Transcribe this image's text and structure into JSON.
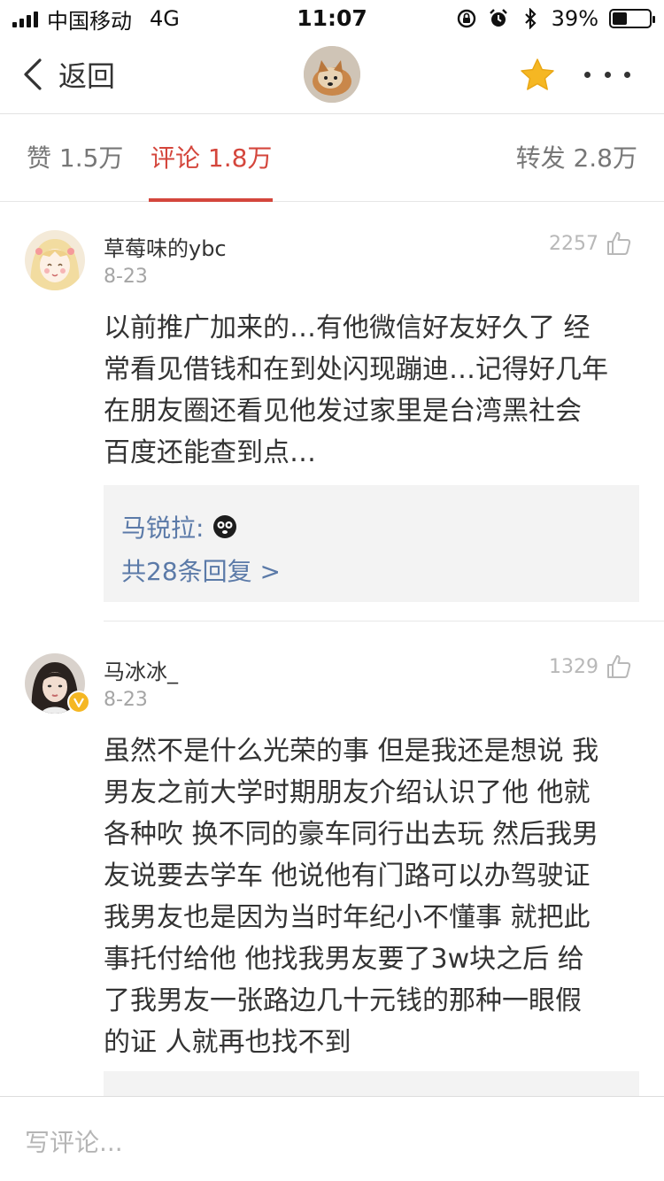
{
  "status_bar": {
    "carrier": "中国移动",
    "network": "4G",
    "time": "11:07",
    "battery_percent": "39%",
    "battery_level": 0.39
  },
  "nav": {
    "back_label": "返回",
    "star_color": "#f5b723"
  },
  "tabs": {
    "likes": "赞 1.5万",
    "comments": "评论 1.8万",
    "reposts": "转发 2.8万",
    "active_color": "#d4463c"
  },
  "comments": [
    {
      "username": "草莓味的ybc",
      "date": "8-23",
      "likes": "2257",
      "lines": [
        "以前推广加来的…有他微信好友好久了 经",
        "常看见借钱和在到处闪现蹦迪…记得好几年",
        "在朋友圈还看见他发过家里是台湾黑社会",
        "百度还能查到点…"
      ],
      "reply_author": "马锐拉:",
      "reply_count": "共28条回复 >"
    },
    {
      "username": "马冰冰_",
      "date": "8-23",
      "likes": "1329",
      "lines": [
        "虽然不是什么光荣的事 但是我还是想说 我",
        "男友之前大学时期朋友介绍认识了他 他就",
        "各种吹 换不同的豪车同行出去玩 然后我男",
        "友说要去学车 他说他有门路可以办驾驶证",
        "我男友也是因为当时年纪小不懂事 就把此",
        "事托付给他 他找我男友要了3w块之后 给",
        "了我男友一张路边几十元钱的那种一眼假",
        "的证 人就再也找不到"
      ]
    }
  ],
  "bottom": {
    "input_placeholder": "写评论..."
  }
}
